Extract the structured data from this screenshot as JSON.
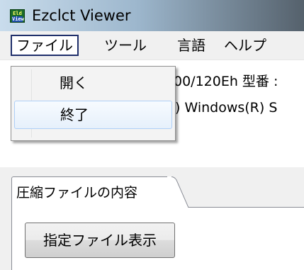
{
  "window": {
    "title": "Ezclct Viewer",
    "icon_name": "app-icon",
    "icon_text": "Eld View"
  },
  "menubar": {
    "items": [
      {
        "label": "ファイル"
      },
      {
        "label": "ツール"
      },
      {
        "label": "言語"
      },
      {
        "label": "ヘルプ"
      }
    ]
  },
  "content": {
    "line1": "00/120Eh 型番 :",
    "line2": ") Windows(R) S"
  },
  "dropdown": {
    "items": [
      {
        "label": "開く"
      },
      {
        "label": "終了"
      }
    ]
  },
  "tabs": [
    {
      "label": "圧縮ファイルの内容"
    }
  ],
  "panel": {
    "button_label": "指定ファイル表示"
  },
  "colors": {
    "menu_active_border": "#1f2f6b",
    "dropdown_hover_border": "#aecff7",
    "tab_border": "#898c95"
  }
}
